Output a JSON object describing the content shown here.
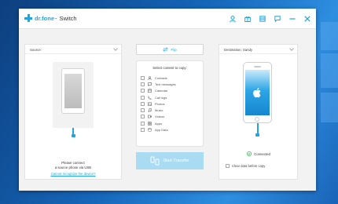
{
  "app": {
    "brand": "dr.fone",
    "separator": "-",
    "title": "Switch"
  },
  "toolbar": {
    "icons": [
      "account-icon",
      "gift-icon",
      "cart-icon",
      "feedback-icon",
      "minimize-icon",
      "close-icon"
    ]
  },
  "source": {
    "header": "Source:",
    "message_line1": "Please connect",
    "message_line2": "a source phone via USB",
    "link": "Cannot recognize the device?"
  },
  "middle": {
    "flip_label": "Flip",
    "copy_title": "Select content to copy:",
    "items": [
      {
        "label": "Contacts",
        "icon": "contacts-icon"
      },
      {
        "label": "Text messages",
        "icon": "messages-icon"
      },
      {
        "label": "Calendar",
        "icon": "calendar-icon"
      },
      {
        "label": "Call logs",
        "icon": "call-log-icon"
      },
      {
        "label": "Photos",
        "icon": "photos-icon"
      },
      {
        "label": "Music",
        "icon": "music-icon"
      },
      {
        "label": "Videos",
        "icon": "videos-icon"
      },
      {
        "label": "Apps",
        "icon": "apps-icon"
      },
      {
        "label": "App Data",
        "icon": "app-data-icon"
      }
    ],
    "start_label": "Start Transfer"
  },
  "destination": {
    "header": "Destination: Sandy",
    "status": "Connected",
    "clear_label": "Clear data before copy"
  },
  "colors": {
    "accent": "#1fa5e2",
    "start_button": "#a9dcf3",
    "connected_green": "#2fb34a"
  }
}
